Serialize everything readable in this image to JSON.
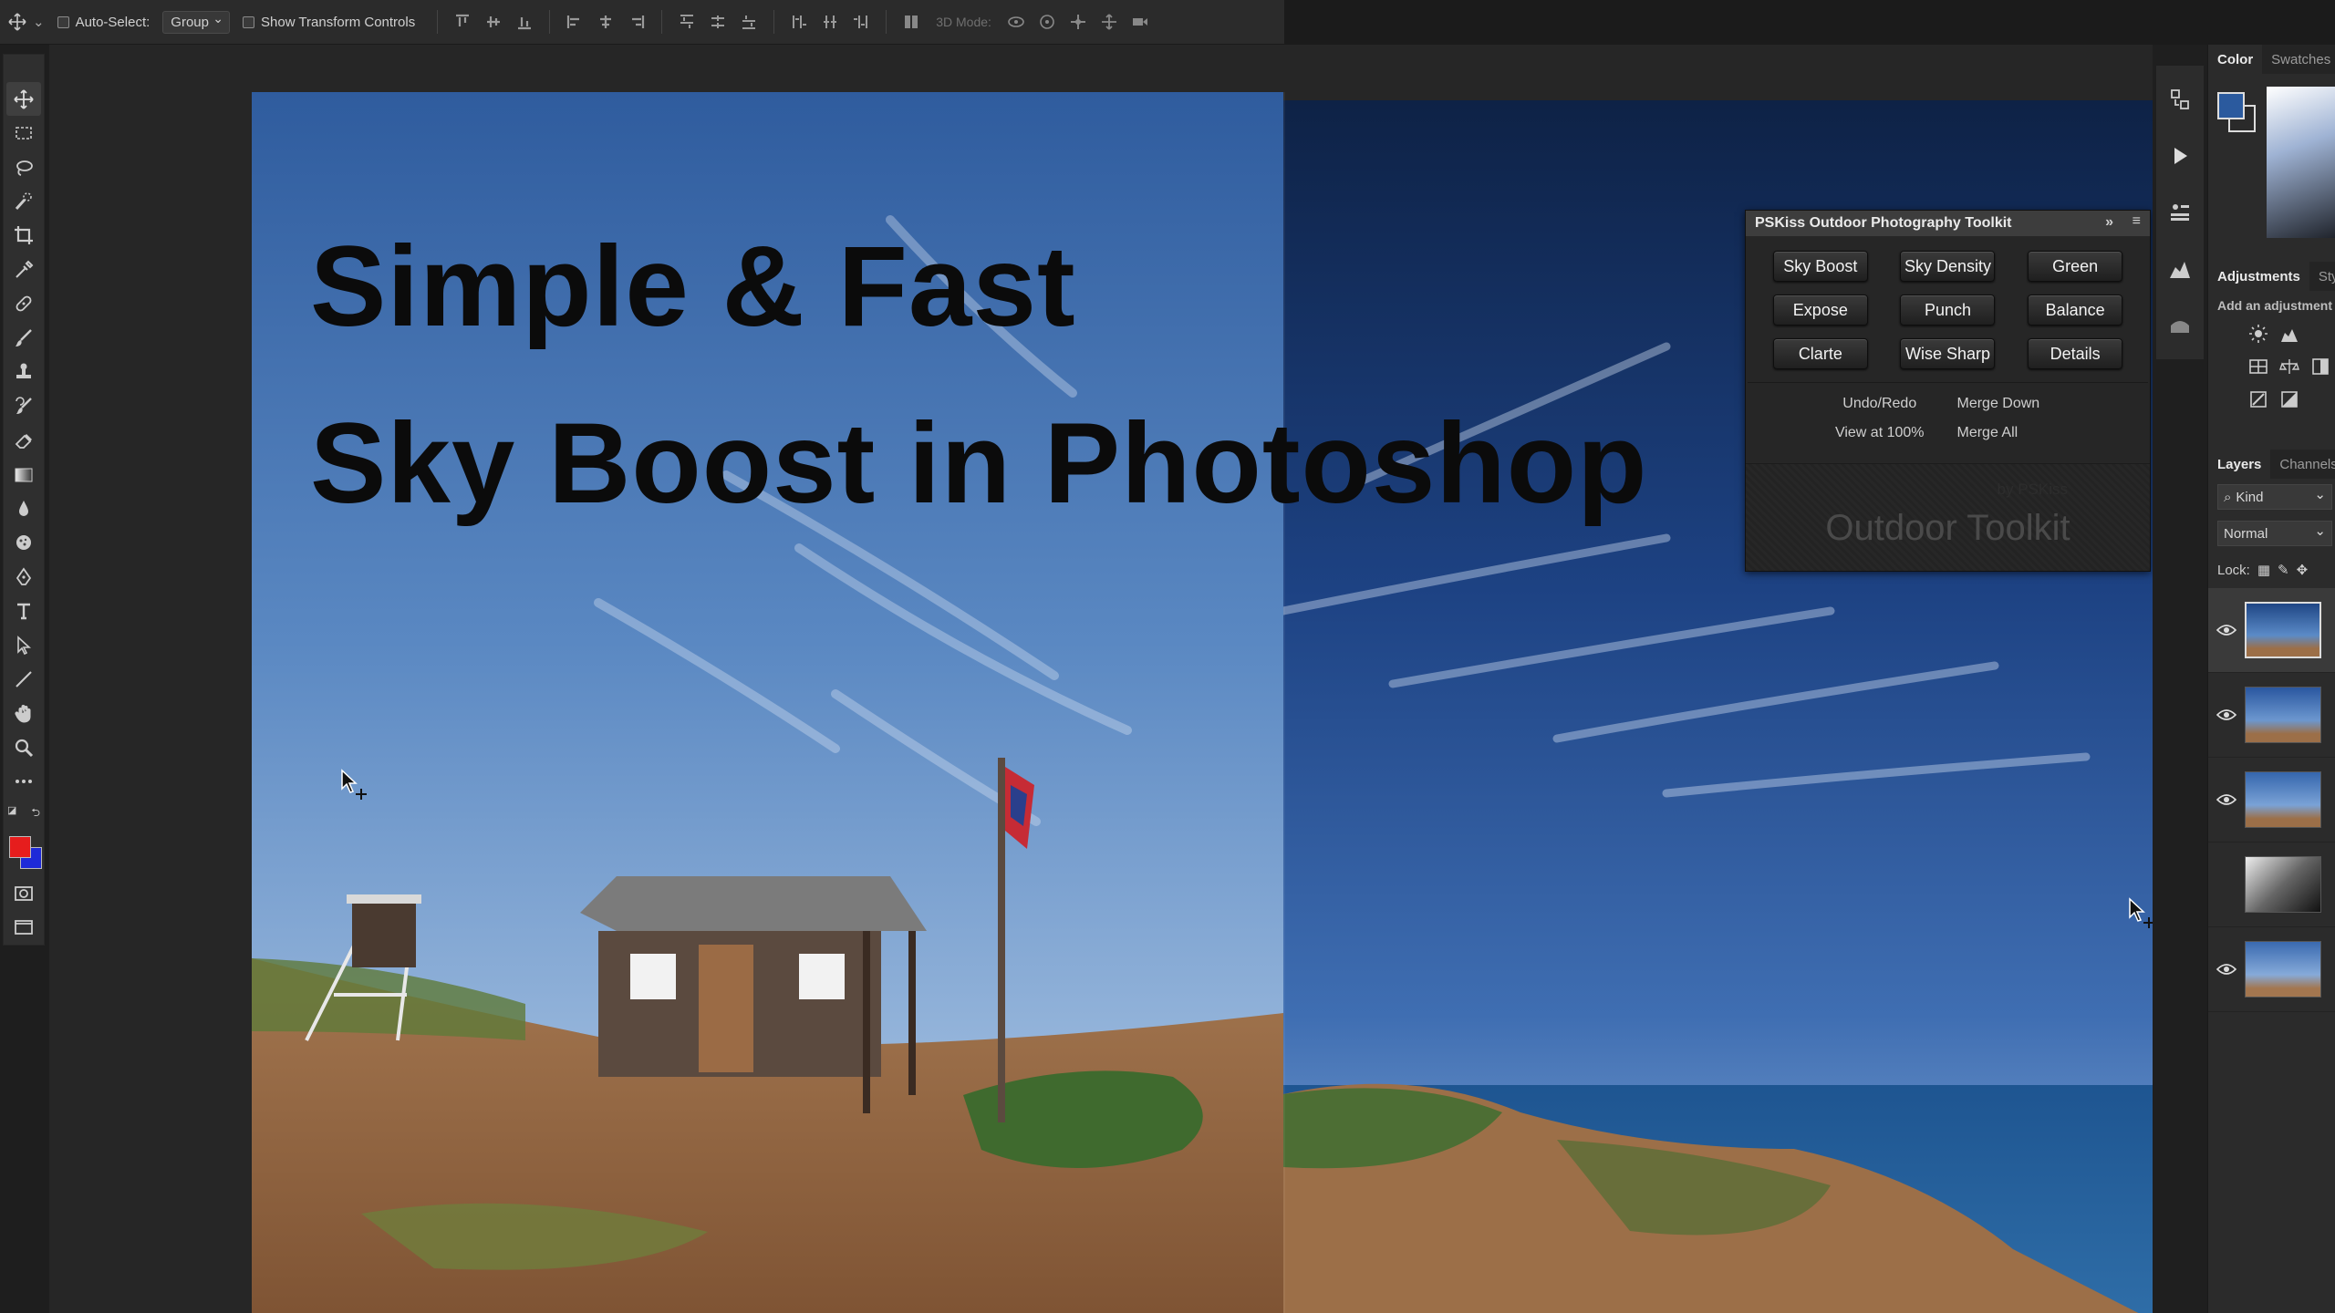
{
  "options_bar": {
    "auto_select_label": "Auto-Select:",
    "auto_select_value": "Group",
    "transform_label": "Show Transform Controls",
    "mode_3d_label": "3D Mode:"
  },
  "tools": [
    {
      "name": "move-tool"
    },
    {
      "name": "marquee-tool"
    },
    {
      "name": "lasso-tool"
    },
    {
      "name": "quick-select-tool"
    },
    {
      "name": "crop-tool"
    },
    {
      "name": "eyedropper-tool"
    },
    {
      "name": "healing-brush-tool"
    },
    {
      "name": "brush-tool"
    },
    {
      "name": "clone-stamp-tool"
    },
    {
      "name": "history-brush-tool"
    },
    {
      "name": "eraser-tool"
    },
    {
      "name": "gradient-tool"
    },
    {
      "name": "blur-tool"
    },
    {
      "name": "dodge-tool"
    },
    {
      "name": "pen-tool"
    },
    {
      "name": "type-tool"
    },
    {
      "name": "path-select-tool"
    },
    {
      "name": "line-tool"
    },
    {
      "name": "hand-tool"
    },
    {
      "name": "zoom-tool"
    },
    {
      "name": "more-tools"
    }
  ],
  "colors": {
    "foreground": "#e61d1d",
    "background": "#1e2ad8",
    "color_panel_fg": "#2b5a9e"
  },
  "canvas": {
    "title_line_1": "Simple & Fast",
    "title_line_2": "Sky Boost in Photoshop"
  },
  "pskiss_panel": {
    "title": "PSKiss Outdoor Photography Toolkit",
    "collapse_glyph": "»",
    "menu_glyph": "≡",
    "buttons": [
      "Sky Boost",
      "Sky Density",
      "Green",
      "Expose",
      "Punch",
      "Balance",
      "Clarte",
      "Wise Sharp",
      "Details"
    ],
    "links": [
      "Undo/Redo",
      "Merge Down",
      "View at 100%",
      "Merge All"
    ],
    "logo_sub": "by PSKiss",
    "logo_text": "Outdoor Toolkit"
  },
  "right_panels": {
    "color_tabs": [
      "Color",
      "Swatches"
    ],
    "adjust_tabs": [
      "Adjustments",
      "Styles"
    ],
    "adjust_hint": "Add an adjustment",
    "layers_tabs": [
      "Layers",
      "Channels"
    ],
    "kind_filter": "Kind",
    "blend_mode": "Normal",
    "lock_label": "Lock:"
  }
}
